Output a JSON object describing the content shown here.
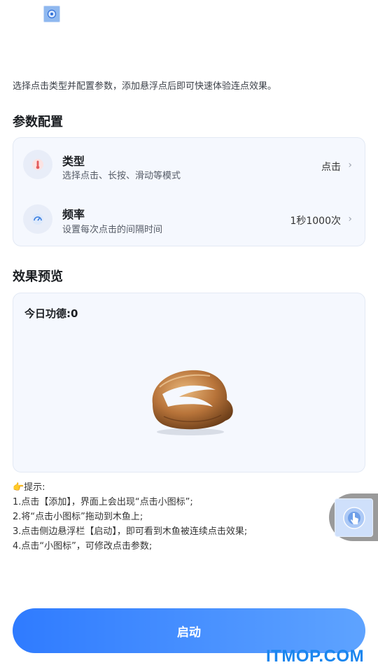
{
  "app": {
    "icon": "app-logo-icon"
  },
  "intro": "选择点击类型并配置参数，添加悬浮点后即可快速体验连点效果。",
  "config": {
    "title": "参数配置",
    "rows": [
      {
        "title": "类型",
        "subtitle": "选择点击、长按、滑动等模式",
        "value": "点击",
        "icon": "tap-icon"
      },
      {
        "title": "频率",
        "subtitle": "设置每次点击的间隔时间",
        "value": "1秒1000次",
        "icon": "speedometer-icon"
      }
    ]
  },
  "preview": {
    "title": "效果预览",
    "merit_label": "今日功德:0",
    "image": "wooden-fish-image"
  },
  "tips": {
    "header": "👉提示:",
    "items": [
      "1.点击【添加】，界面上会出现“点击小图标”;",
      "2.将“点击小图标”拖动到木鱼上;",
      "3.点击侧边悬浮栏【启动】，即可看到木鱼被连续点击效果;",
      "4.点击“小图标”，可修改点击参数;"
    ]
  },
  "floating_widget": {
    "icon": "tap-target-icon"
  },
  "start_button": "启动",
  "watermark": "ITMOP.COM",
  "colors": {
    "accent": "#2f7bff",
    "card_bg": "#f5f8fe",
    "watermark": "#1a86ee"
  }
}
